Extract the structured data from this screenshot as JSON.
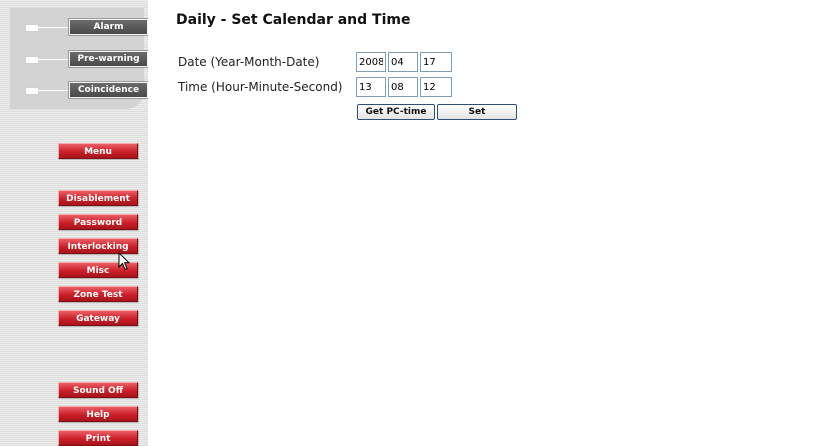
{
  "status": {
    "alarm": "Alarm",
    "prewarning": "Pre-warning",
    "coincidence": "Coincidence"
  },
  "menu": {
    "menu": "Menu",
    "disablement": "Disablement",
    "password": "Password",
    "interlocking": "Interlocking",
    "misc": "Misc",
    "zone_test": "Zone Test",
    "gateway": "Gateway",
    "sound_off": "Sound Off",
    "help": "Help",
    "print": "Print"
  },
  "page": {
    "title": "Daily - Set Calendar and Time",
    "date_label": "Date (Year-Month-Date)",
    "time_label": "Time (Hour-Minute-Second)",
    "year": "2008",
    "month": "04",
    "day": "17",
    "hour": "13",
    "minute": "08",
    "second": "12",
    "get_pc_time": "Get PC-time",
    "set": "Set"
  },
  "colors": {
    "menu_button": "#cc1f29",
    "status_button": "#5a5a5a"
  }
}
